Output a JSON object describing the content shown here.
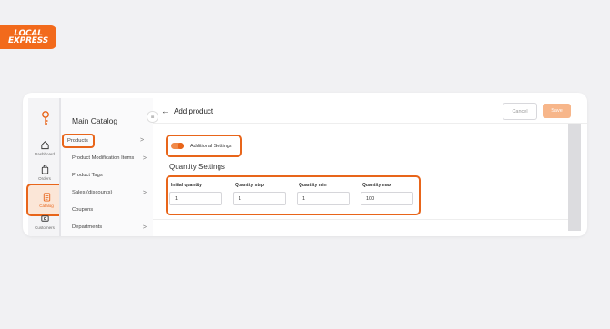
{
  "brand": {
    "line1": "LOCAL",
    "line2": "EXPRESS",
    "accent": "#f26a1b"
  },
  "rail": {
    "items": [
      {
        "label": "Dashboard",
        "icon": "home-icon"
      },
      {
        "label": "Orders",
        "icon": "bag-icon"
      },
      {
        "label": "Catalog",
        "icon": "catalog-icon",
        "active": true
      },
      {
        "label": "Customers",
        "icon": "customers-icon"
      }
    ]
  },
  "menu": {
    "title": "Main Catalog",
    "items": [
      {
        "label": "Products",
        "has_children": true,
        "highlighted": true
      },
      {
        "label": "Product Modification Items",
        "has_children": true
      },
      {
        "label": "Product Tags",
        "has_children": false
      },
      {
        "label": "Sales (discounts)",
        "has_children": true
      },
      {
        "label": "Coupons",
        "has_children": false
      },
      {
        "label": "Departments",
        "has_children": true
      }
    ]
  },
  "header": {
    "title": "Add product",
    "cancel_label": "Cancel",
    "save_label": "Save"
  },
  "additional_settings": {
    "label": "Additional Settings",
    "enabled": true
  },
  "quantity": {
    "title": "Quantity Settings",
    "fields": [
      {
        "label": "Initial quantity",
        "value": "1"
      },
      {
        "label": "Quantity step",
        "value": "1"
      },
      {
        "label": "Quantity min",
        "value": "1"
      },
      {
        "label": "Quantity max",
        "value": "100"
      }
    ]
  }
}
